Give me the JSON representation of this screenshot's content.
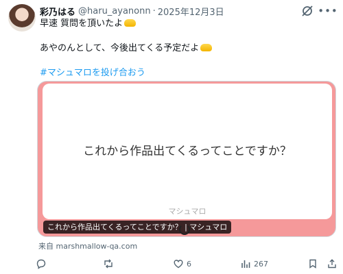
{
  "post": {
    "display_name": "彩乃はる",
    "handle": "@haru_ayanonn",
    "separator": "·",
    "date": "2025年12月3日",
    "text_line1": "早速 質問を頂いたよ",
    "text_line2": "あやのんとして、今後出てくる予定だよ",
    "hashtag": "#マシュマロを投げ合おう"
  },
  "card": {
    "question": "これから作品出てくるってことですか？",
    "brand": "マシュマロ",
    "caption": "これから作品出てくるってことですか？ | マシュマロ",
    "background_color": "#f5999a"
  },
  "source": {
    "label": "来自 marshmallow-qa.com"
  },
  "actions": {
    "reply": {
      "icon": "reply-icon",
      "count": ""
    },
    "repost": {
      "icon": "repost-icon",
      "count": ""
    },
    "like": {
      "icon": "heart-icon",
      "count": "6"
    },
    "views": {
      "icon": "views-icon",
      "count": "267"
    },
    "bookmark": {
      "icon": "bookmark-icon"
    },
    "share": {
      "icon": "share-icon"
    }
  },
  "colors": {
    "link": "#1d9bf0",
    "muted": "#536471",
    "text": "#0f1419"
  }
}
